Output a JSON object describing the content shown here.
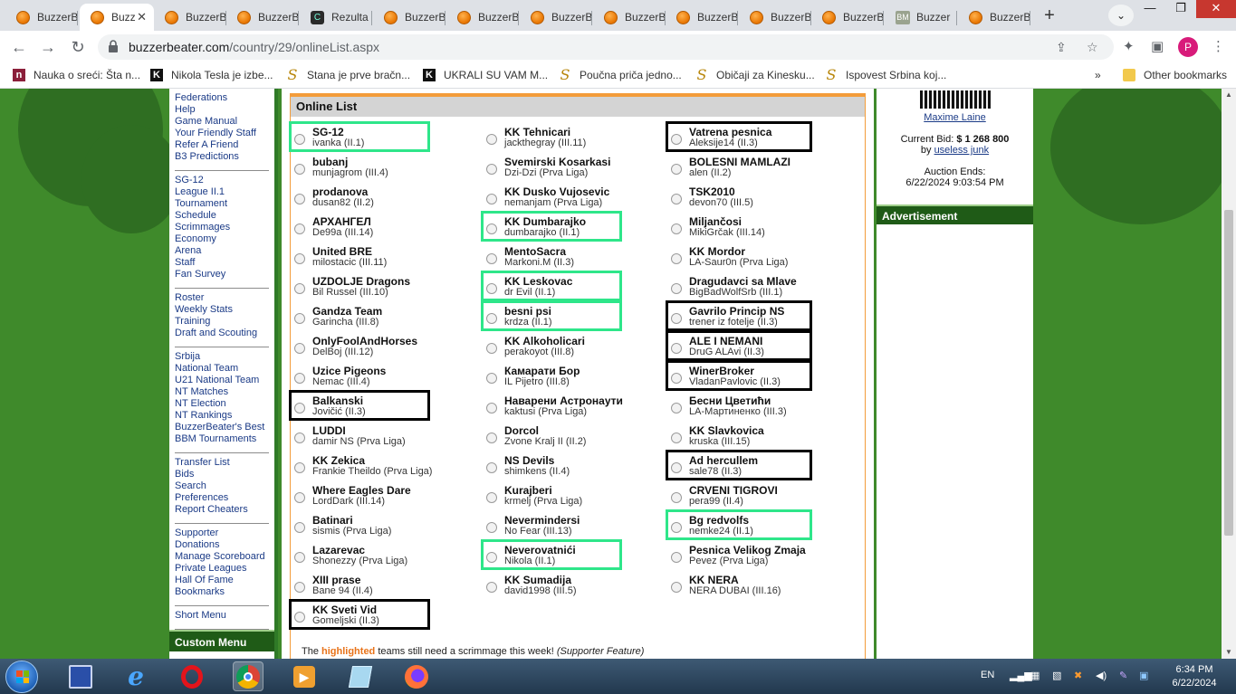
{
  "browser": {
    "tabs": [
      {
        "label": "BuzzerB",
        "icon": "ball"
      },
      {
        "label": "Buzz",
        "icon": "ball",
        "active": true
      },
      {
        "label": "BuzzerB",
        "icon": "ball"
      },
      {
        "label": "BuzzerB",
        "icon": "ball"
      },
      {
        "label": "Rezulta",
        "icon": "square"
      },
      {
        "label": "BuzzerB",
        "icon": "ball"
      },
      {
        "label": "BuzzerB",
        "icon": "ball"
      },
      {
        "label": "BuzzerB",
        "icon": "ball"
      },
      {
        "label": "BuzzerB",
        "icon": "ball"
      },
      {
        "label": "BuzzerB",
        "icon": "ball"
      },
      {
        "label": "BuzzerB",
        "icon": "ball"
      },
      {
        "label": "BuzzerB",
        "icon": "ball"
      },
      {
        "label": "Buzzer",
        "icon": "bm"
      },
      {
        "label": "BuzzerB",
        "icon": "ball"
      }
    ],
    "tab_close": "✕",
    "new_tab": "+",
    "url_host": "buzzerbeater.com",
    "url_path": "/country/29/onlineList.aspx",
    "avatar_letter": "P",
    "bookmarks": [
      {
        "label": "Nauka o sreći: Šta n...",
        "icon": "n"
      },
      {
        "label": "Nikola Tesla je izbe...",
        "icon": "k"
      },
      {
        "label": "Stana je prve bračn...",
        "icon": "s"
      },
      {
        "label": "UKRALI SU VAM M...",
        "icon": "k"
      },
      {
        "label": "Poučna priča jedno...",
        "icon": "s"
      },
      {
        "label": "Običaji za Kinesku...",
        "icon": "s"
      },
      {
        "label": "Ispovest Srbina koj...",
        "icon": "s"
      }
    ],
    "bookmarks_more": "»",
    "other_bookmarks": "Other bookmarks"
  },
  "leftnav": {
    "groups": [
      [
        "Federations",
        "Help",
        "Game Manual",
        "Your Friendly Staff",
        "Refer A Friend",
        "B3 Predictions"
      ],
      [
        "SG-12",
        "League II.1",
        "Tournament",
        "Schedule",
        "Scrimmages",
        "Economy",
        "Arena",
        "Staff",
        "Fan Survey"
      ],
      [
        "Roster",
        "Weekly Stats",
        "Training",
        "Draft and Scouting"
      ],
      [
        "Srbija",
        "National Team",
        "U21 National Team",
        "NT Matches",
        "NT Election",
        "NT Rankings",
        "BuzzerBeater's Best",
        "BBM Tournaments"
      ],
      [
        "Transfer List",
        "Bids",
        "Search",
        "Preferences",
        "Report Cheaters"
      ],
      [
        "Supporter",
        "Donations",
        "Manage Scoreboard",
        "Private Leagues",
        "Hall Of Fame",
        "Bookmarks"
      ],
      [
        "Short Menu"
      ]
    ],
    "custom_menu": "Custom Menu"
  },
  "online_list": {
    "title": "Online List",
    "columns": [
      [
        {
          "team": "SG-12",
          "manager": "ivanka (II.1)",
          "box": "green"
        },
        {
          "team": "bubanj",
          "manager": "munjagrom (III.4)"
        },
        {
          "team": "prodanova",
          "manager": "dusan82 (II.2)"
        },
        {
          "team": "АРХАНГЕЛ",
          "manager": "De99a (III.14)"
        },
        {
          "team": "United BRE",
          "manager": "milostacic (III.11)"
        },
        {
          "team": "UZDOLJE Dragons",
          "manager": "Bil Russel (III.10)"
        },
        {
          "team": "Gandza Team",
          "manager": "Garincha (III.8)"
        },
        {
          "team": "OnlyFoolAndHorses",
          "manager": "DelBoj (III.12)"
        },
        {
          "team": "Uzice Pigeons",
          "manager": "Nemac (III.4)"
        },
        {
          "team": "Balkanski",
          "manager": "Jovičić (II.3)",
          "box": "black"
        },
        {
          "team": "LUDDI",
          "manager": "damir NS (Prva Liga)"
        },
        {
          "team": "KK Zekica",
          "manager": "Frankie Theildo (Prva Liga)"
        },
        {
          "team": "Where Eagles Dare",
          "manager": "LordDark (III.14)"
        },
        {
          "team": "Batinari",
          "manager": "sismis (Prva Liga)"
        },
        {
          "team": "Lazarevac",
          "manager": "Shonezzy (Prva Liga)"
        },
        {
          "team": "XIII prase",
          "manager": "Bane 94 (II.4)"
        },
        {
          "team": "KK Sveti Vid",
          "manager": "Gomeljski (II.3)",
          "box": "black"
        }
      ],
      [
        {
          "team": "KK Tehnicari",
          "manager": "jackthegray (III.11)"
        },
        {
          "team": "Svemirski Kosarkasi",
          "manager": "Dzi-Dzi (Prva Liga)"
        },
        {
          "team": "KK Dusko Vujosevic",
          "manager": "nemanjam (Prva Liga)"
        },
        {
          "team": "KK Dumbarajko",
          "manager": "dumbarajko (II.1)",
          "box": "green"
        },
        {
          "team": "MentoSacra",
          "manager": "Markoni.M (II.3)"
        },
        {
          "team": "KK Leskovac",
          "manager": "dr Evil (II.1)",
          "box": "green"
        },
        {
          "team": "besni psi",
          "manager": "krdza (II.1)",
          "box": "green"
        },
        {
          "team": "KK Alkoholicari",
          "manager": "perakoyot (III.8)"
        },
        {
          "team": "Камарати Бор",
          "manager": "IL Pijetro (III.8)"
        },
        {
          "team": "Наварени Астронаути",
          "manager": "kaktusi (Prva Liga)"
        },
        {
          "team": "Dorcol",
          "manager": "Zvone Kralj II (II.2)"
        },
        {
          "team": "NS Devils",
          "manager": "shimkens (II.4)"
        },
        {
          "team": "Kurajberi",
          "manager": "krmelj (Prva Liga)"
        },
        {
          "team": "Nevermindersi",
          "manager": "No Fear (III.13)"
        },
        {
          "team": "Neverovatnići",
          "manager": "Nikola (II.1)",
          "box": "green"
        },
        {
          "team": "KK Sumadija",
          "manager": "david1998 (III.5)"
        }
      ],
      [
        {
          "team": "Vatrena pesnica",
          "manager": "Aleksije14 (II.3)",
          "box": "black"
        },
        {
          "team": "BOLESNI MAMLAZI",
          "manager": "alen (II.2)"
        },
        {
          "team": "TSK2010",
          "manager": "devon70 (III.5)"
        },
        {
          "team": "Miljančosi",
          "manager": "MikiGrčak (III.14)"
        },
        {
          "team": "KK Mordor",
          "manager": "LA-Saur0n (Prva Liga)"
        },
        {
          "team": "Dragudavci sa Mlave",
          "manager": "BigBadWolfSrb (III.1)"
        },
        {
          "team": "Gavrilo Princip NS",
          "manager": "trener iz fotelje (II.3)",
          "box": "black"
        },
        {
          "team": "ALE I NEMANI",
          "manager": "DruG ALAvi (II.3)",
          "box": "black"
        },
        {
          "team": "WinerBroker",
          "manager": "VladanPavlovic (II.3)",
          "box": "black"
        },
        {
          "team": "Бесни Цветићи",
          "manager": "LA-Мартиненко (III.3)"
        },
        {
          "team": "KK Slavkovica",
          "manager": "kruska (III.15)"
        },
        {
          "team": "Ad hercullem",
          "manager": "sale78 (II.3)",
          "box": "black"
        },
        {
          "team": "CRVENI TIGROVI",
          "manager": "pera99 (II.4)"
        },
        {
          "team": "Bg redvolfs",
          "manager": "nemke24 (II.1)",
          "box": "green"
        },
        {
          "team": "Pesnica Velikog Zmaja",
          "manager": "Pevez (Prva Liga)"
        },
        {
          "team": "KK NERA",
          "manager": "NERA DUBAI (III.16)"
        }
      ]
    ],
    "footnote_pre": "The ",
    "footnote_hl": "highlighted",
    "footnote_post": " teams still need a scrimmage this week! ",
    "footnote_feature": "(Supporter Feature)"
  },
  "auction": {
    "seller": "Maxime Laine",
    "bid_label": "Current Bid: ",
    "bid_value": "$ 1 268 800",
    "by_label": "by ",
    "bidder": "useless junk",
    "ends_label": "Auction Ends:",
    "ends_value": "6/22/2024 9:03:54 PM",
    "ad_header": "Advertisement"
  },
  "taskbar": {
    "lang": "EN",
    "time": "6:34 PM",
    "date": "6/22/2024"
  },
  "colors": {
    "page_green": "#3f8a2b",
    "header_green": "#1f5b17",
    "panel_orange": "#f39c3a",
    "highlight_green": "#2ee68a"
  }
}
